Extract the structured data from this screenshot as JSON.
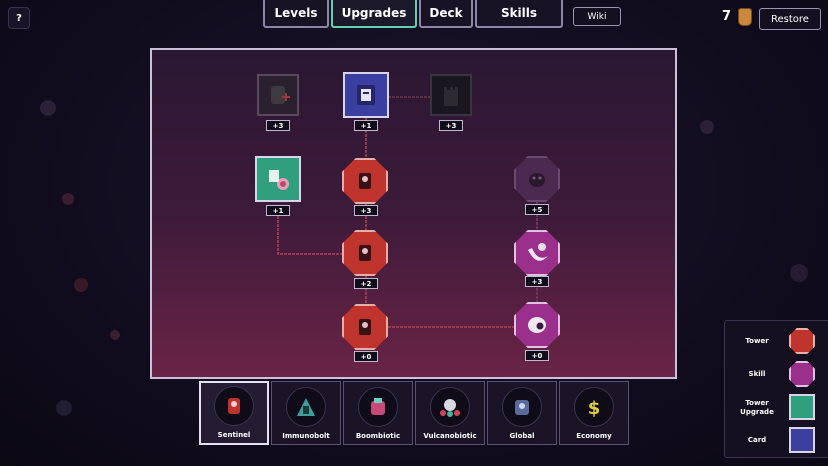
{
  "hud": {
    "help_label": "?",
    "tabs": [
      {
        "label": "Levels",
        "active": false
      },
      {
        "label": "Upgrades",
        "active": true
      },
      {
        "label": "Deck",
        "active": false
      },
      {
        "label": "Skills",
        "active": false
      }
    ],
    "wiki_label": "Wiki",
    "resource_count": "7",
    "resource_icon": "potion-icon",
    "restore_label": "Restore"
  },
  "tree": {
    "nodes": [
      {
        "name": "node-heal",
        "type": "locked-tower",
        "cost": "+3",
        "icon": "heal-tower-icon"
      },
      {
        "name": "node-book",
        "type": "card",
        "cost": "+1",
        "icon": "book-icon"
      },
      {
        "name": "node-dark-castle",
        "type": "locked-tower",
        "cost": "+3",
        "icon": "castle-icon"
      },
      {
        "name": "node-green",
        "type": "tower-upgrade",
        "cost": "+1",
        "icon": "snail-icon"
      },
      {
        "name": "node-red-1",
        "type": "tower",
        "cost": "+3",
        "icon": "tower-icon"
      },
      {
        "name": "node-purple-locked",
        "type": "skill-locked",
        "cost": "+5",
        "icon": "beast-icon"
      },
      {
        "name": "node-red-2",
        "type": "tower",
        "cost": "+2",
        "icon": "tower-icon"
      },
      {
        "name": "node-purple-1",
        "type": "skill",
        "cost": "+3",
        "icon": "crescent-icon"
      },
      {
        "name": "node-red-3",
        "type": "tower",
        "cost": "+0",
        "icon": "tower-icon"
      },
      {
        "name": "node-purple-2",
        "type": "skill",
        "cost": "+0",
        "icon": "ghost-icon"
      }
    ]
  },
  "categories": [
    {
      "label": "Sentinel",
      "active": true,
      "icon": "sentinel-icon"
    },
    {
      "label": "Immunobolt",
      "active": false,
      "icon": "immunobolt-icon"
    },
    {
      "label": "Boombiotic",
      "active": false,
      "icon": "boombiotic-icon"
    },
    {
      "label": "Vulcanobiotic",
      "active": false,
      "icon": "vulcanobiotic-icon"
    },
    {
      "label": "Global",
      "active": false,
      "icon": "global-icon"
    },
    {
      "label": "Economy",
      "active": false,
      "icon": "dollar-icon"
    }
  ],
  "legend": [
    {
      "label": "Tower",
      "color": "#c0342e"
    },
    {
      "label": "Skill",
      "color": "#9a2f8c"
    },
    {
      "label": "Tower Upgrade",
      "color": "#2f9f7d"
    },
    {
      "label": "Card",
      "color": "#3a3fa0"
    }
  ],
  "colors": {
    "accent_tab": "#5fd2ad",
    "panel_border": "#c8c2da",
    "tower": "#c0342e",
    "skill": "#9a2f8c",
    "upgrade": "#2f9f7d",
    "card": "#3a3fa0"
  }
}
